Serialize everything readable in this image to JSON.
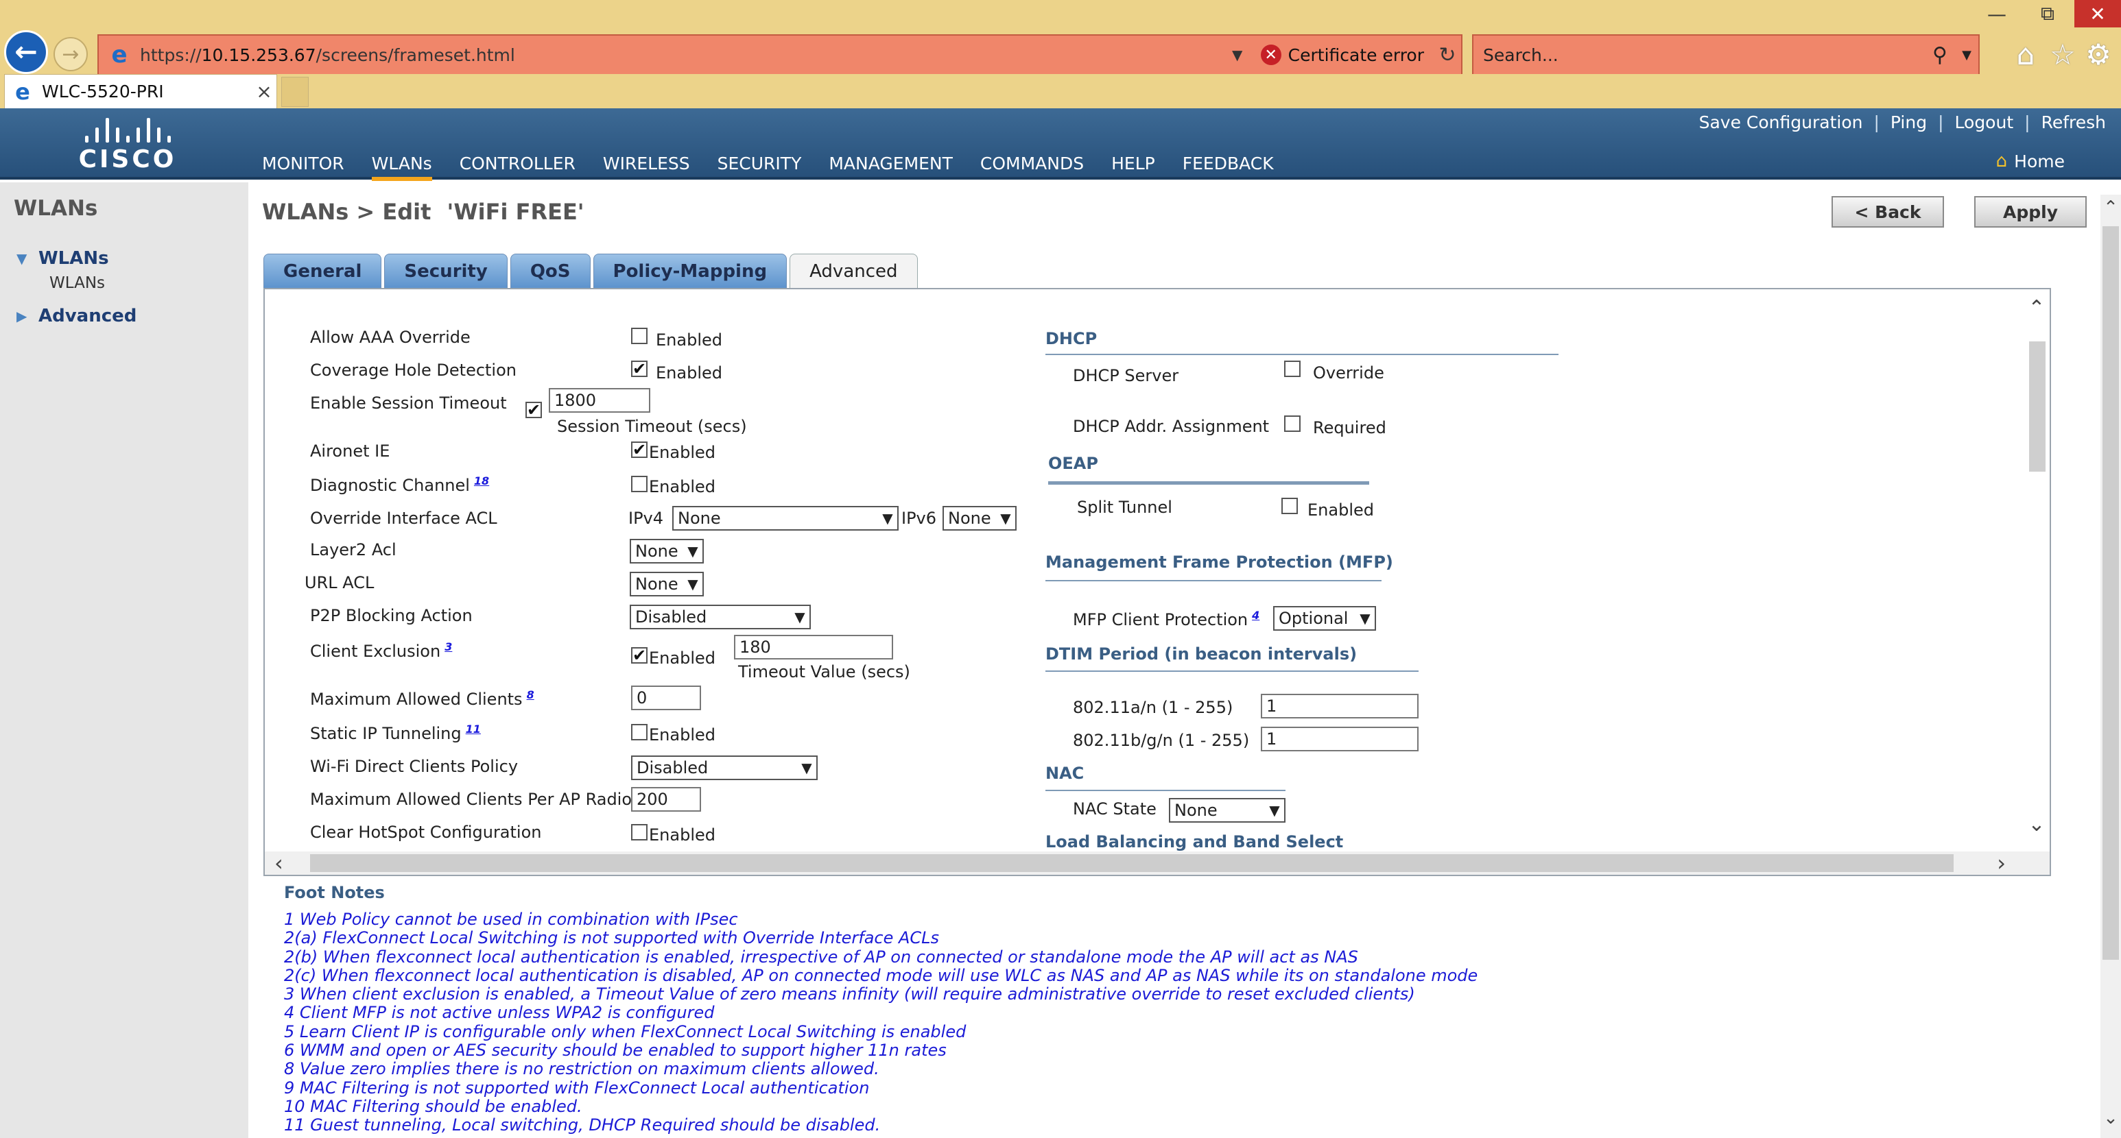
{
  "browser": {
    "url_prefix": "https://",
    "url_host": "10.15.253.67",
    "url_path": "/screens/frameset.html",
    "cert_error": "Certificate error",
    "search_placeholder": "Search...",
    "tab_title": "WLC-5520-PRI"
  },
  "header": {
    "brand": "CISCO",
    "top_links": [
      "Save Configuration",
      "Ping",
      "Logout",
      "Refresh"
    ],
    "nav": [
      "MONITOR",
      "WLANs",
      "CONTROLLER",
      "WIRELESS",
      "SECURITY",
      "MANAGEMENT",
      "COMMANDS",
      "HELP",
      "FEEDBACK"
    ],
    "active_nav": "WLANs",
    "home": "Home"
  },
  "sidebar": {
    "title": "WLANs",
    "tree": [
      {
        "label": "WLANs",
        "child": "WLANs"
      },
      {
        "label": "Advanced"
      }
    ]
  },
  "page": {
    "breadcrumb": "WLANs > Edit",
    "wlan_name": "'WiFi FREE'",
    "back_label": "< Back",
    "apply_label": "Apply"
  },
  "tabs": [
    "General",
    "Security",
    "QoS",
    "Policy-Mapping",
    "Advanced"
  ],
  "active_tab": "Advanced",
  "left": {
    "allow_aaa_override": {
      "label": "Allow AAA Override",
      "text": "Enabled",
      "checked": false
    },
    "coverage_hole": {
      "label": "Coverage Hole Detection",
      "text": "Enabled",
      "checked": true
    },
    "session_timeout": {
      "label": "Enable Session Timeout",
      "checked": true,
      "value": "1800",
      "caption": "Session Timeout (secs)"
    },
    "aironet_ie": {
      "label": "Aironet IE",
      "text": "Enabled",
      "checked": true
    },
    "diagnostic_channel": {
      "label": "Diagnostic Channel",
      "fn": "18",
      "text": "Enabled",
      "checked": false
    },
    "override_acl": {
      "label": "Override Interface ACL",
      "ipv4_label": "IPv4",
      "ipv4_value": "None",
      "ipv6_label": "IPv6",
      "ipv6_value": "None"
    },
    "layer2_acl": {
      "label": "Layer2 Acl",
      "value": "None"
    },
    "url_acl": {
      "label": "URL ACL",
      "value": "None"
    },
    "p2p_blocking": {
      "label": "P2P Blocking Action",
      "value": "Disabled"
    },
    "client_exclusion": {
      "label": "Client Exclusion",
      "fn": "3",
      "text": "Enabled",
      "checked": true,
      "value": "180",
      "caption": "Timeout Value (secs)"
    },
    "max_clients": {
      "label": "Maximum Allowed Clients",
      "fn": "8",
      "value": "0"
    },
    "static_ip_tunneling": {
      "label": "Static IP Tunneling",
      "fn": "11",
      "text": "Enabled",
      "checked": false
    },
    "wifi_direct": {
      "label": "Wi-Fi Direct Clients Policy",
      "value": "Disabled"
    },
    "max_clients_per_ap": {
      "label": "Maximum Allowed Clients Per AP Radio",
      "value": "200"
    },
    "clear_hotspot": {
      "label": "Clear HotSpot Configuration",
      "text": "Enabled",
      "checked": false
    }
  },
  "right": {
    "dhcp": {
      "title": "DHCP",
      "server_label": "DHCP Server",
      "server_text": "Override",
      "server_checked": false,
      "addr_label": "DHCP Addr. Assignment",
      "addr_text": "Required",
      "addr_checked": false
    },
    "oeap": {
      "title": "OEAP",
      "split_label": "Split Tunnel",
      "split_text": "Enabled",
      "split_checked": false
    },
    "mfp": {
      "title": "Management Frame Protection (MFP)",
      "label": "MFP Client Protection",
      "fn": "4",
      "value": "Optional"
    },
    "dtim": {
      "title": "DTIM Period (in beacon intervals)",
      "a_label": "802.11a/n (1 - 255)",
      "a_value": "1",
      "b_label": "802.11b/g/n (1 - 255)",
      "b_value": "1"
    },
    "nac": {
      "title": "NAC",
      "label": "NAC State",
      "value": "None"
    },
    "load_balancing": {
      "title": "Load Balancing and Band Select"
    }
  },
  "footnotes": {
    "title": "Foot Notes",
    "lines": [
      "1 Web Policy cannot be used in combination with IPsec",
      "2(a) FlexConnect Local Switching is not supported with Override Interface ACLs",
      "2(b) When flexconnect local authentication is enabled, irrespective of AP on connected or standalone mode the AP will act as NAS",
      "2(c) When flexconnect local authentication is disabled, AP on connected mode will use WLC as NAS and AP as NAS while its on standalone mode",
      "3 When client exclusion is enabled, a Timeout Value of zero means infinity (will require administrative override to reset excluded clients)",
      "4 Client MFP is not active unless WPA2 is configured",
      "5 Learn Client IP is configurable only when FlexConnect Local Switching is enabled",
      "6 WMM and open or AES security should be enabled to support higher 11n rates",
      "8 Value zero implies there is no restriction on maximum clients allowed.",
      "9 MAC Filtering is not supported with FlexConnect Local authentication",
      "10 MAC Filtering should be enabled.",
      "11 Guest tunneling, Local switching, DHCP Required should be disabled."
    ]
  },
  "colors": {
    "header": "#2f5c87",
    "tab": "#6d9fd4",
    "accent": "#f4a51c",
    "footnote": "#1b1bd6",
    "address_error": "#f0866a"
  }
}
